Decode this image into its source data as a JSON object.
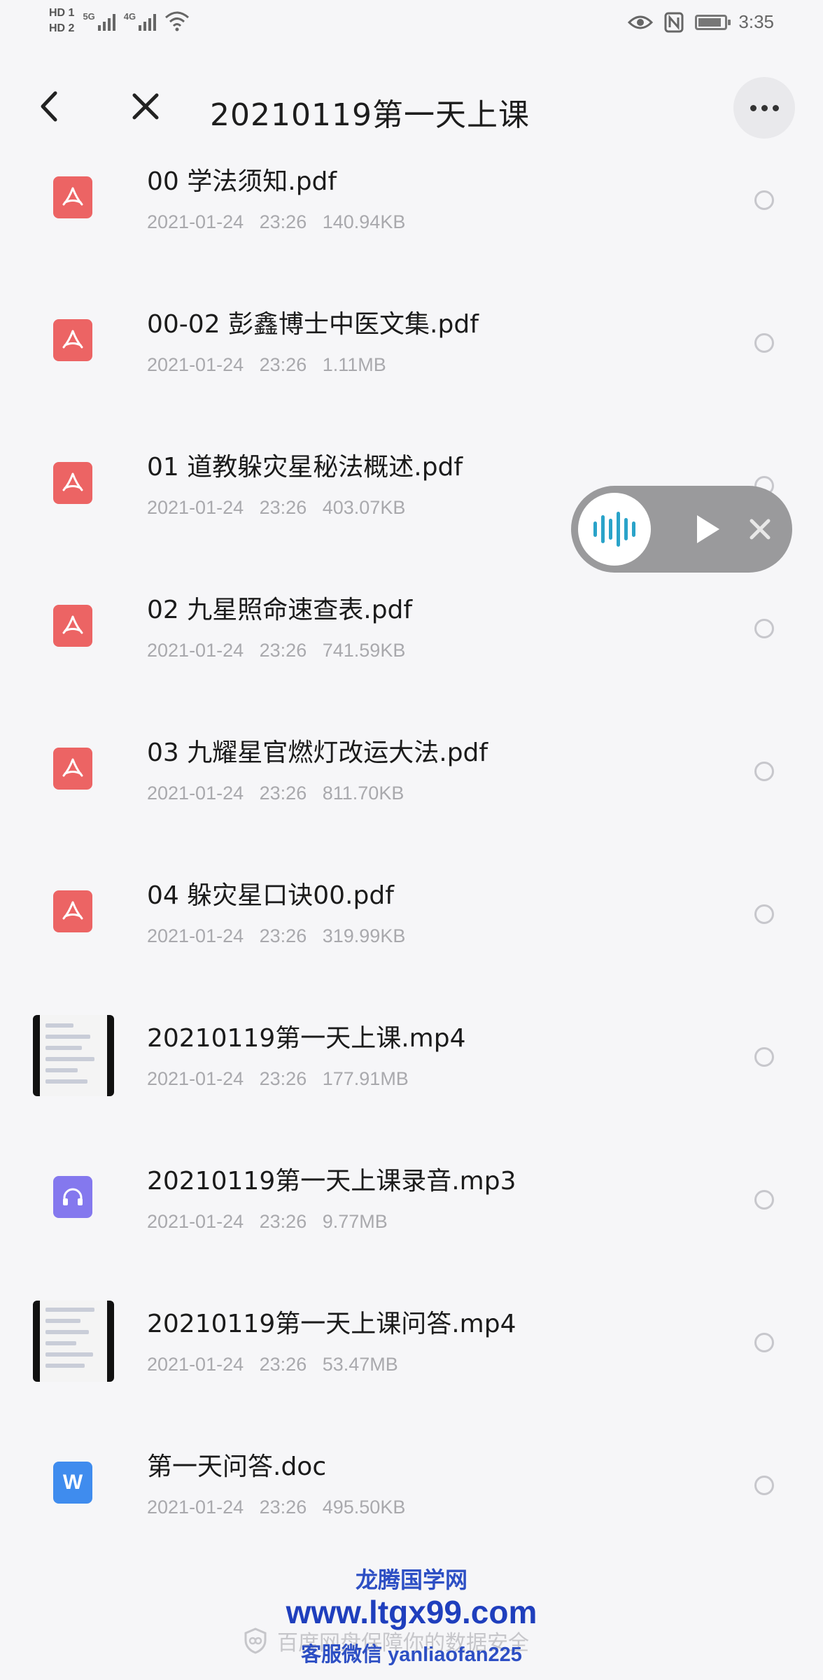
{
  "status_bar": {
    "hd1": "HD 1",
    "hd2": "HD 2",
    "net1": "5G",
    "net2": "4G",
    "time": "3:35",
    "icons": [
      "eye-icon",
      "nfc-icon",
      "battery-icon",
      "wifi-icon",
      "signal-icon"
    ]
  },
  "header": {
    "title": "20210119第一天上课",
    "back_icon": "chevron-left-icon",
    "close_icon": "close-icon",
    "more_icon": "more-horizontal-icon"
  },
  "files": [
    {
      "name": "00  学法须知.pdf",
      "date": "2021-01-24",
      "time": "23:26",
      "size": "140.94KB",
      "type": "pdf"
    },
    {
      "name": "00-02   彭鑫博士中医文集.pdf",
      "date": "2021-01-24",
      "time": "23:26",
      "size": "1.11MB",
      "type": "pdf"
    },
    {
      "name": "01  道教躲灾星秘法概述.pdf",
      "date": "2021-01-24",
      "time": "23:26",
      "size": "403.07KB",
      "type": "pdf"
    },
    {
      "name": "02  九星照命速查表.pdf",
      "date": "2021-01-24",
      "time": "23:26",
      "size": "741.59KB",
      "type": "pdf"
    },
    {
      "name": "03  九耀星官燃灯改运大法.pdf",
      "date": "2021-01-24",
      "time": "23:26",
      "size": "811.70KB",
      "type": "pdf"
    },
    {
      "name": "04  躲灾星口诀00.pdf",
      "date": "2021-01-24",
      "time": "23:26",
      "size": "319.99KB",
      "type": "pdf"
    },
    {
      "name": "20210119第一天上课.mp4",
      "date": "2021-01-24",
      "time": "23:26",
      "size": "177.91MB",
      "type": "video"
    },
    {
      "name": "20210119第一天上课录音.mp3",
      "date": "2021-01-24",
      "time": "23:26",
      "size": "9.77MB",
      "type": "audio"
    },
    {
      "name": "20210119第一天上课问答.mp4",
      "date": "2021-01-24",
      "time": "23:26",
      "size": "53.47MB",
      "type": "video"
    },
    {
      "name": "第一天问答.doc",
      "date": "2021-01-24",
      "time": "23:26",
      "size": "495.50KB",
      "type": "doc"
    }
  ],
  "player": {
    "wave_icon": "audio-wave-icon",
    "play_icon": "play-icon",
    "close_icon": "close-icon"
  },
  "footer": {
    "security_note": "百度网盘保障你的数据安全",
    "watermark_1": "龙腾国学网",
    "watermark_2": "www.ltgx99.com",
    "watermark_3": "客服微信 yanliaofan225"
  },
  "colors": {
    "background": "#f6f6f8",
    "pdf": "#ec6464",
    "audio": "#8478ee",
    "doc": "#3f8cee",
    "meta_text": "#a9a9ad",
    "watermark": "#1f3fbd"
  }
}
